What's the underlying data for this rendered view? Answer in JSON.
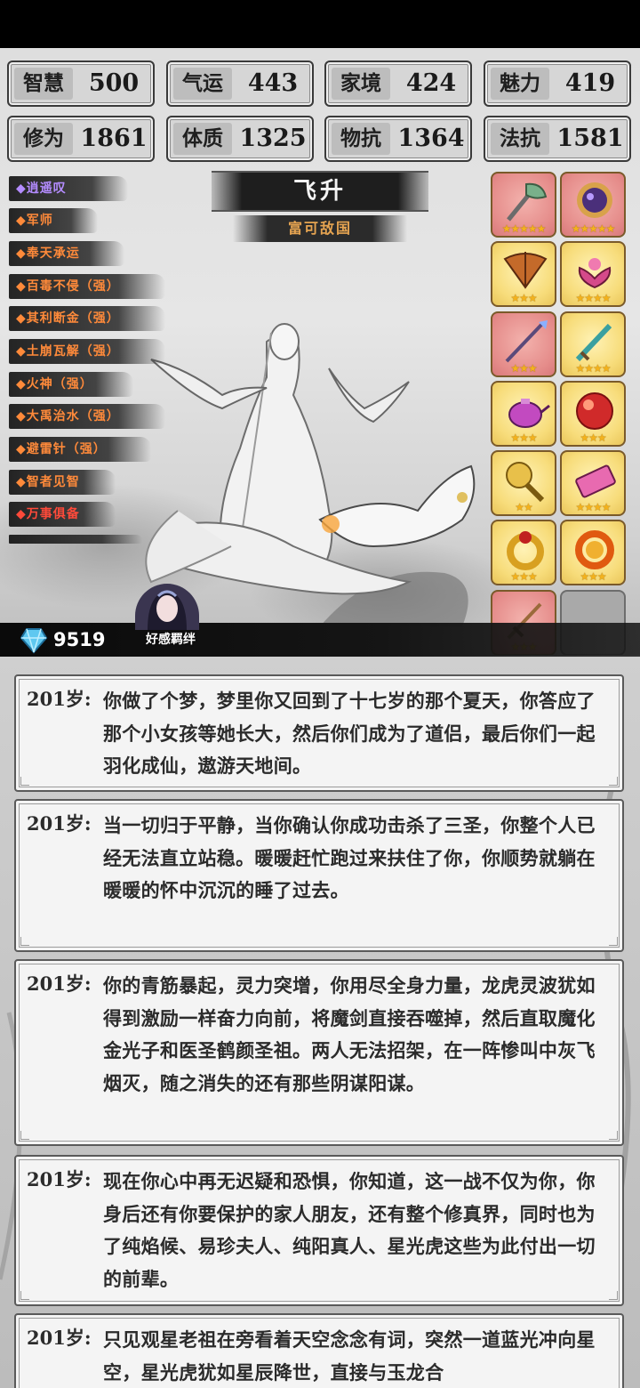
{
  "stats": [
    {
      "label": "智慧",
      "value": "500"
    },
    {
      "label": "气运",
      "value": "443"
    },
    {
      "label": "家境",
      "value": "424"
    },
    {
      "label": "魅力",
      "value": "419"
    },
    {
      "label": "修为",
      "value": "1861"
    },
    {
      "label": "体质",
      "value": "1325"
    },
    {
      "label": "物抗",
      "value": "1364"
    },
    {
      "label": "法抗",
      "value": "1581"
    }
  ],
  "traits": [
    {
      "label": "◆逍遥叹",
      "color": "#b48cff"
    },
    {
      "label": "◆军师",
      "color": "#ff8a3a"
    },
    {
      "label": "◆奉天承运",
      "color": "#ff8a3a"
    },
    {
      "label": "◆百毒不侵（强）",
      "color": "#ff8a3a"
    },
    {
      "label": "◆其利断金（强）",
      "color": "#ff8a3a"
    },
    {
      "label": "◆土崩瓦解（强）",
      "color": "#ff8a3a"
    },
    {
      "label": "◆火神（强）",
      "color": "#ff8a3a"
    },
    {
      "label": "◆大禹治水（强）",
      "color": "#ff8a3a"
    },
    {
      "label": "◆避雷针（强）",
      "color": "#ff8a3a"
    },
    {
      "label": "◆智者见智",
      "color": "#ff8a3a"
    },
    {
      "label": "◆万事俱备",
      "color": "#ff4a3a"
    }
  ],
  "title": "飞升",
  "subtitle": "富可敌国",
  "items": [
    {
      "icon": "jade-axe-icon",
      "stars": "★★★★★",
      "bg": "pink"
    },
    {
      "icon": "magic-mirror-icon",
      "stars": "★★★★★",
      "bg": "pink"
    },
    {
      "icon": "war-fan-icon",
      "stars": "★★★",
      "bg": "gold"
    },
    {
      "icon": "lotus-icon",
      "stars": "★★★★",
      "bg": "gold"
    },
    {
      "icon": "spear-icon",
      "stars": "★★★",
      "bg": "pink"
    },
    {
      "icon": "jade-sword-icon",
      "stars": "★★★★",
      "bg": "gold"
    },
    {
      "icon": "teapot-icon",
      "stars": "★★★",
      "bg": "gold"
    },
    {
      "icon": "fire-orb-icon",
      "stars": "★★★",
      "bg": "gold"
    },
    {
      "icon": "golden-rattle-icon",
      "stars": "★★",
      "bg": "gold"
    },
    {
      "icon": "scroll-icon",
      "stars": "★★★★",
      "bg": "gold"
    },
    {
      "icon": "gold-ring-icon",
      "stars": "★★★",
      "bg": "gold"
    },
    {
      "icon": "fire-ring-icon",
      "stars": "★★★",
      "bg": "gold"
    },
    {
      "icon": "sword-icon",
      "stars": "★★★",
      "bg": "pink"
    },
    {
      "icon": "",
      "stars": "",
      "bg": "empty"
    }
  ],
  "currency": "9519",
  "affinity_label": "好感羁绊",
  "logs": [
    {
      "age": "201岁:",
      "text": "你做了个梦，梦里你又回到了十七岁的那个夏天，你答应了那个小女孩等她长大，然后你们成为了道侣，最后你们一起羽化成仙，遨游天地间。"
    },
    {
      "age": "201岁:",
      "text": "当一切归于平静，当你确认你成功击杀了三圣，你整个人已经无法直立站稳。暖暖赶忙跑过来扶住了你，你顺势就躺在暖暖的怀中沉沉的睡了过去。"
    },
    {
      "age": "201岁:",
      "text": "你的青筋暴起，灵力突增，你用尽全身力量，龙虎灵波犹如得到激励一样奋力向前，将魔剑直接吞噬掉，然后直取魔化金光子和医圣鹤颜圣祖。两人无法招架，在一阵惨叫中灰飞烟灭，随之消失的还有那些阴谋阳谋。"
    },
    {
      "age": "201岁:",
      "text": "现在你心中再无迟疑和恐惧，你知道，这一战不仅为你，你身后还有你要保护的家人朋友，还有整个修真界，同时也为了纯焰候、易珍夫人、纯阳真人、星光虎这些为此付出一切的前辈。"
    },
    {
      "age": "201岁:",
      "text": "只见观星老祖在旁看着天空念念有词，突然一道蓝光冲向星空，星光虎犹如星辰降世，直接与玉龙合"
    }
  ]
}
